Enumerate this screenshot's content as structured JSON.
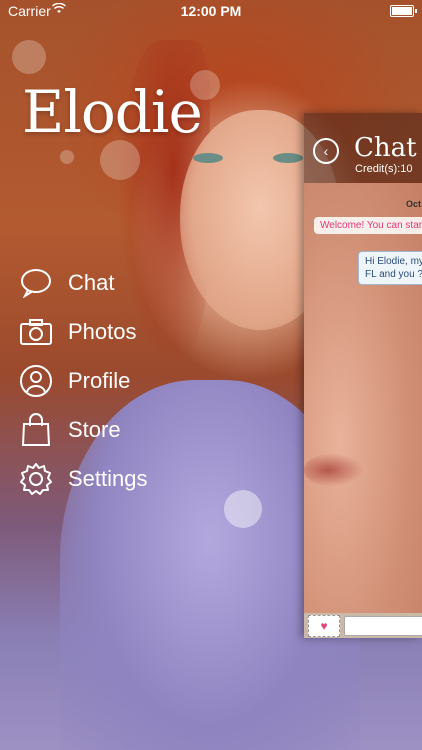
{
  "status_bar": {
    "carrier": "Carrier",
    "wifi_icon": "wifi-icon",
    "time": "12:00 PM",
    "battery_icon": "battery-icon"
  },
  "app": {
    "logo_text": "Elodie"
  },
  "menu": {
    "items": [
      {
        "label": "Chat",
        "icon": "chat-bubble-icon"
      },
      {
        "label": "Photos",
        "icon": "camera-icon"
      },
      {
        "label": "Profile",
        "icon": "user-profile-icon"
      },
      {
        "label": "Store",
        "icon": "shopping-bag-icon"
      },
      {
        "label": "Settings",
        "icon": "gear-icon"
      }
    ]
  },
  "chat_panel": {
    "title": "Chat",
    "credits": "Credit(s):10",
    "date_label": "Oct",
    "messages": [
      {
        "direction": "in",
        "text": "Welcome! You can star"
      },
      {
        "direction": "out",
        "text_line1": "Hi Elodie, my",
        "text_line2": "FL and you ?"
      }
    ],
    "stamp_icon": "heart-stamp-icon",
    "input_placeholder": ""
  },
  "colors": {
    "accent_pink": "#e03a7a",
    "message_blue": "#2a4d7a"
  }
}
